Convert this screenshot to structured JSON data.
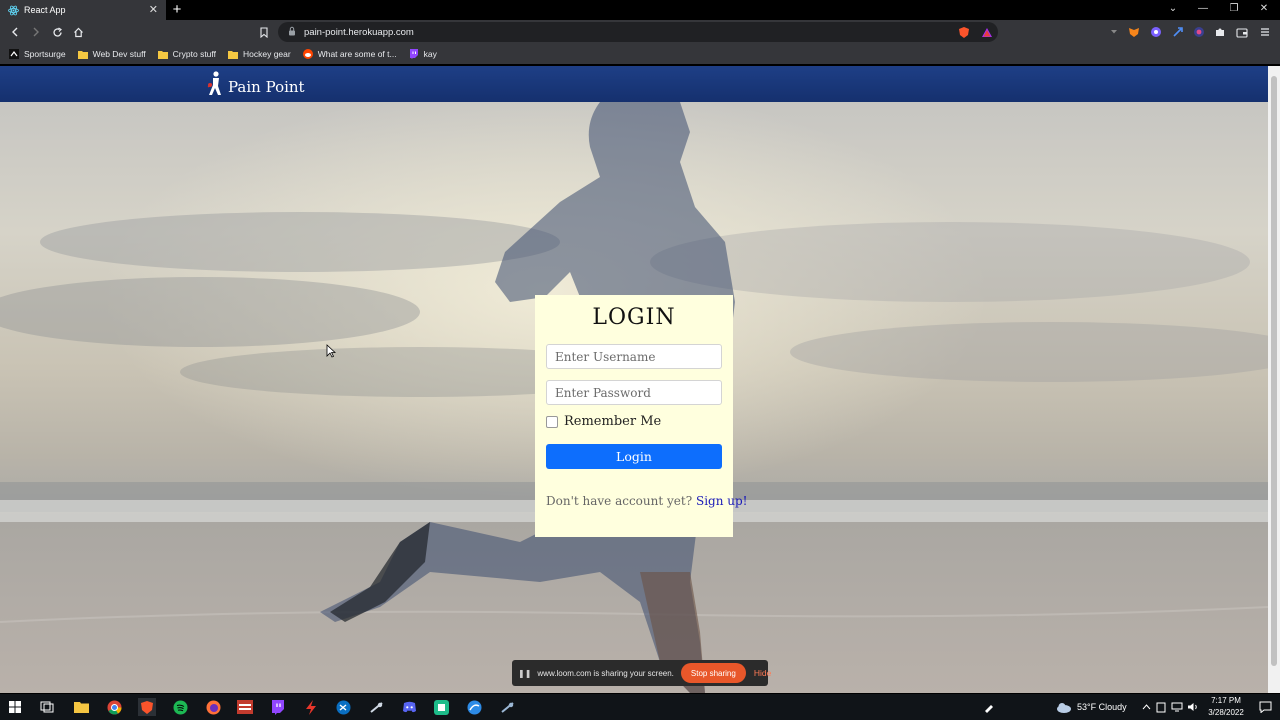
{
  "browser": {
    "tab_title": "React App",
    "url": "pain-point.herokuapp.com",
    "bookmarks": [
      {
        "label": "Sportsurge",
        "icon": "sportsurge-icon"
      },
      {
        "label": "Web Dev stuff",
        "icon": "folder-icon"
      },
      {
        "label": "Crypto stuff",
        "icon": "folder-icon"
      },
      {
        "label": "Hockey gear",
        "icon": "folder-icon"
      },
      {
        "label": "What are some of t...",
        "icon": "reddit-icon"
      },
      {
        "label": "kay",
        "icon": "twitch-icon"
      }
    ]
  },
  "app": {
    "brand": "Pain Point",
    "brand_icon": "runner-logo-icon"
  },
  "login": {
    "title": "LOGIN",
    "username_placeholder": "Enter Username",
    "password_placeholder": "Enter Password",
    "remember_label": "Remember Me",
    "remember_checked": false,
    "button_label": "Login",
    "signup_prompt": "Don't have account yet?",
    "signup_link": "Sign up!"
  },
  "screen_share": {
    "message": "www.loom.com is sharing your screen.",
    "stop_label": "Stop sharing",
    "hide_label": "Hide"
  },
  "taskbar": {
    "weather": "53°F  Cloudy",
    "time": "7:17 PM",
    "date": "3/28/2022"
  },
  "colors": {
    "navbar": "#1a3a7c",
    "card_bg": "#ffffde",
    "login_button": "#0d6efd",
    "stop_sharing": "#e8572a"
  }
}
